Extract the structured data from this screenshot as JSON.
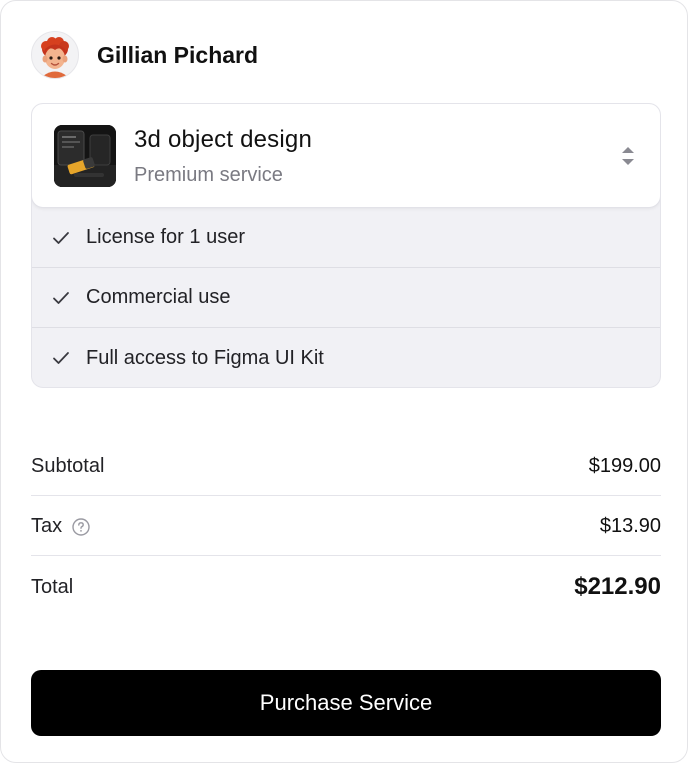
{
  "user": {
    "name": "Gillian Pichard",
    "avatar_icon": "memoji-avatar"
  },
  "product": {
    "title": "3d object design",
    "subtitle": "Premium service",
    "thumbnail_icon": "product-thumbnail",
    "selector_icon": "chevron-up-down-icon"
  },
  "features": [
    {
      "label": "License for 1 user",
      "icon": "check-icon"
    },
    {
      "label": "Commercial use",
      "icon": "check-icon"
    },
    {
      "label": "Full access to Figma UI Kit",
      "icon": "check-icon"
    }
  ],
  "summary": {
    "subtotal_label": "Subtotal",
    "subtotal_value": "$199.00",
    "tax_label": "Tax",
    "tax_value": "$13.90",
    "tax_help_icon": "help-circle-icon",
    "total_label": "Total",
    "total_value": "$212.90"
  },
  "actions": {
    "purchase_label": "Purchase Service"
  },
  "colors": {
    "primary_button": "#000000",
    "features_background": "#f1f1f5",
    "muted_text": "#7a7a82"
  }
}
